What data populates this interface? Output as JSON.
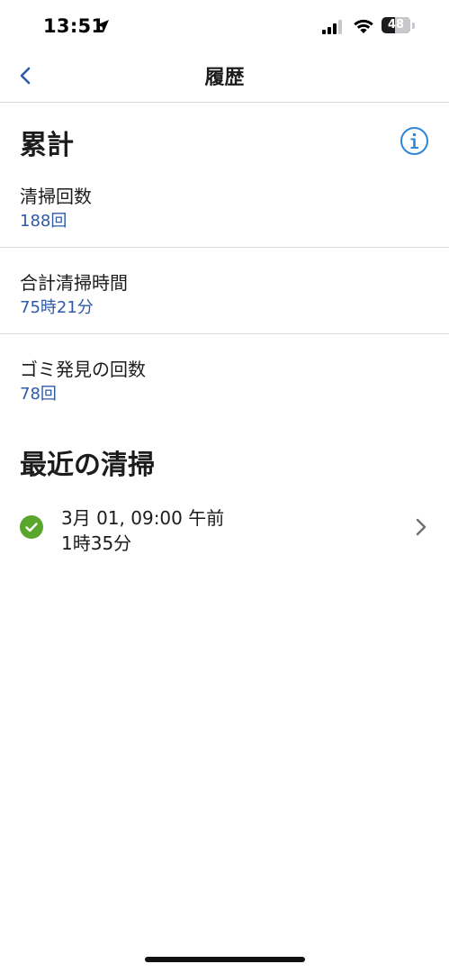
{
  "status_bar": {
    "time": "13:51",
    "battery_level": "48",
    "battery_fraction": 0.48
  },
  "nav": {
    "title": "履歴",
    "back_icon": "chevron-left-icon"
  },
  "summary": {
    "heading": "累計",
    "info_icon": "info-icon",
    "stats": [
      {
        "label": "清掃回数",
        "value": "188回"
      },
      {
        "label": "合計清掃時間",
        "value": "75時21分"
      },
      {
        "label": "ゴミ発見の回数",
        "value": "78回"
      }
    ]
  },
  "recent": {
    "heading": "最近の清掃",
    "items": [
      {
        "date": "3月 01, 09:00 午前",
        "duration": "1時35分",
        "status": "completed"
      }
    ]
  },
  "colors": {
    "accent": "#2e5aa7",
    "info_blue": "#2f86d8",
    "success_green": "#5aa52c",
    "text": "#1c1c1e",
    "divider": "#dcdcdf"
  }
}
